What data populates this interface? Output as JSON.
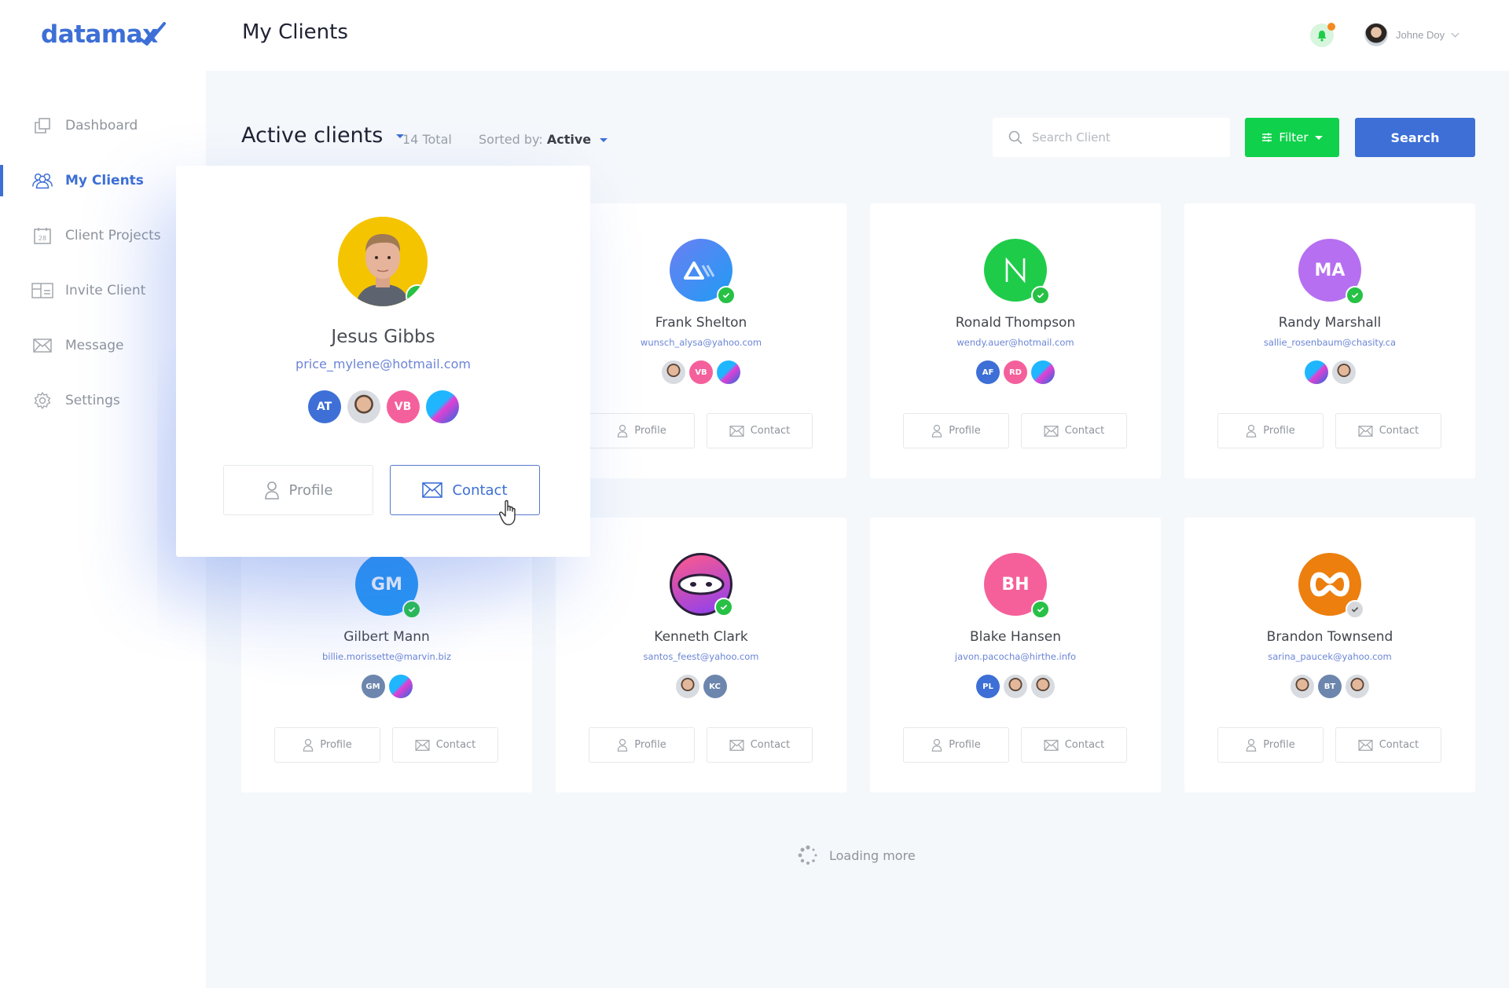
{
  "app": {
    "logo": "datamax",
    "page_title": "My Clients"
  },
  "header": {
    "notifications": {
      "has_unread": true
    },
    "user": {
      "name": "Johne Doy"
    }
  },
  "sidebar": {
    "items": [
      {
        "label": "Dashboard",
        "icon": "dashboard-icon",
        "active": false
      },
      {
        "label": "My Clients",
        "icon": "users-icon",
        "active": true
      },
      {
        "label": "Client Projects",
        "icon": "calendar-icon",
        "calendar_day": "28",
        "active": false
      },
      {
        "label": "Invite Client",
        "icon": "invite-card-icon",
        "active": false
      },
      {
        "label": "Message",
        "icon": "mail-icon",
        "active": false
      },
      {
        "label": "Settings",
        "icon": "gear-icon",
        "active": false
      }
    ]
  },
  "toolbar": {
    "view_label": "Active clients",
    "total": "14 Total",
    "sorted_prefix": "Sorted by:",
    "sorted_value": "Active",
    "search_placeholder": "Search Client",
    "search_value": "",
    "filter_label": "Filter",
    "search_label": "Search"
  },
  "colors": {
    "accent": "#3d6fd6",
    "filter_green": "#0fd14b",
    "online_green": "#26c145",
    "notification_orange": "#f5891f"
  },
  "popup": {
    "name": "Jesus Gibbs",
    "email": "price_mylene@hotmail.com",
    "status": "active",
    "team": [
      {
        "type": "initials",
        "text": "AT",
        "color": "#3d6fd6"
      },
      {
        "type": "photo",
        "text": ""
      },
      {
        "type": "initials",
        "text": "VB",
        "color": "#f4609b"
      },
      {
        "type": "art",
        "text": ""
      }
    ],
    "profile_label": "Profile",
    "contact_label": "Contact"
  },
  "clients": [
    {
      "name": "Frank Shelton",
      "email": "wunsch_alysa@yahoo.com",
      "avatar": "logo-am",
      "status": "active",
      "team": [
        {
          "type": "photo",
          "text": ""
        },
        {
          "type": "initials",
          "text": "VB",
          "color": "#f4609b"
        },
        {
          "type": "art",
          "text": ""
        }
      ]
    },
    {
      "name": "Ronald Thompson",
      "email": "wendy.auer@hotmail.com",
      "avatar": "logo-n",
      "status": "active",
      "team": [
        {
          "type": "initials",
          "text": "AF",
          "color": "#3d6fd6"
        },
        {
          "type": "initials",
          "text": "RD",
          "color": "#f4609b"
        },
        {
          "type": "art",
          "text": ""
        }
      ]
    },
    {
      "name": "Randy Marshall",
      "email": "sallie_rosenbaum@chasity.ca",
      "avatar": "MA",
      "avatar_color": "#b66ff0",
      "status": "active",
      "team": [
        {
          "type": "art",
          "text": ""
        },
        {
          "type": "photo",
          "text": ""
        }
      ]
    },
    {
      "name": "Gilbert Mann",
      "email": "billie.morissette@marvin.biz",
      "avatar": "GM",
      "avatar_color": "#2196f3",
      "status": "active",
      "team": [
        {
          "type": "initials",
          "text": "GM",
          "color": "#6d86ad"
        },
        {
          "type": "art",
          "text": ""
        }
      ]
    },
    {
      "name": "Kenneth Clark",
      "email": "santos_feest@yahoo.com",
      "avatar": "logo-ninja",
      "status": "active",
      "team": [
        {
          "type": "photo",
          "text": ""
        },
        {
          "type": "initials",
          "text": "KC",
          "color": "#6d86ad"
        }
      ]
    },
    {
      "name": "Blake Hansen",
      "email": "javon.pacocha@hirthe.info",
      "avatar": "BH",
      "avatar_color": "#f5609a",
      "status": "active",
      "team": [
        {
          "type": "initials",
          "text": "PL",
          "color": "#3d6fd6"
        },
        {
          "type": "photo",
          "text": ""
        },
        {
          "type": "photo",
          "text": ""
        }
      ]
    },
    {
      "name": "Brandon Townsend",
      "email": "sarina_paucek@yahoo.com",
      "avatar": "logo-infinity",
      "status": "inactive",
      "team": [
        {
          "type": "photo",
          "text": ""
        },
        {
          "type": "initials",
          "text": "BT",
          "color": "#6d86ad"
        },
        {
          "type": "photo",
          "text": ""
        }
      ]
    }
  ],
  "card_buttons": {
    "profile": "Profile",
    "contact": "Contact"
  },
  "loading_text": "Loading more"
}
